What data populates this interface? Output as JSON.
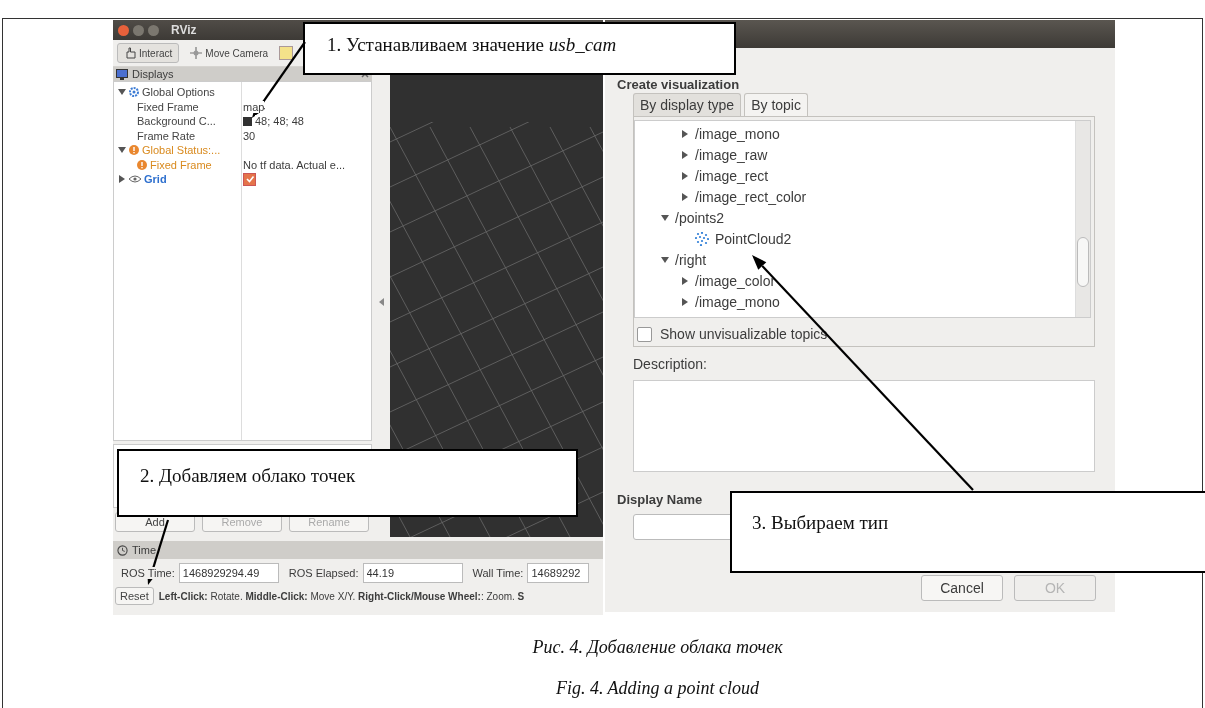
{
  "rviz_window": {
    "title": "RViz",
    "toolbar": [
      {
        "label": "Interact",
        "selected": true
      },
      {
        "label": "Move Camera",
        "selected": false
      }
    ],
    "displays_panel": {
      "title": "Displays",
      "items": [
        {
          "label": "Global Options",
          "kind": "options",
          "expanded": true,
          "children": [
            {
              "label": "Fixed Frame",
              "kind": "property",
              "value": "map"
            },
            {
              "label": "Background C...",
              "kind": "property",
              "value": "48; 48; 48",
              "swatch": true
            },
            {
              "label": "Frame Rate",
              "kind": "property",
              "value": "30"
            }
          ]
        },
        {
          "label": "Global Status:...",
          "kind": "status",
          "expanded": true,
          "children": [
            {
              "label": "Fixed Frame",
              "kind": "status",
              "value": "No tf data.  Actual e..."
            }
          ]
        },
        {
          "label": "Grid",
          "kind": "display",
          "expanded": false,
          "checked": true
        }
      ]
    },
    "panel_buttons": [
      {
        "label": "Add",
        "disabled": false
      },
      {
        "label": "Remove",
        "disabled": true
      },
      {
        "label": "Rename",
        "disabled": true
      }
    ],
    "time_panel": {
      "title": "Time",
      "fields": [
        {
          "label": "ROS Time:",
          "value": "1468929294.49"
        },
        {
          "label": "ROS Elapsed:",
          "value": "44.19"
        },
        {
          "label": "Wall Time:",
          "value": "14689292"
        }
      ],
      "reset_button": "Reset",
      "hint": "**Left-Click:** Rotate. **Middle-Click:** Move X/Y. **Right-Click/Mouse Wheel:**: Zoom. **S**"
    }
  },
  "dialog": {
    "heading": "Create visualization",
    "tabs": [
      {
        "label": "By display type",
        "selected": false
      },
      {
        "label": "By topic",
        "selected": true
      }
    ],
    "topic_tree": {
      "continued_children": [
        {
          "label": "/image_mono",
          "expanded": false
        },
        {
          "label": "/image_raw",
          "expanded": false
        },
        {
          "label": "/image_rect",
          "expanded": false
        },
        {
          "label": "/image_rect_color",
          "expanded": false
        }
      ],
      "items": [
        {
          "label": "/points2",
          "expanded": true,
          "children": [
            {
              "label": "PointCloud2",
              "kind": "display"
            }
          ]
        },
        {
          "label": "/right",
          "expanded": true,
          "children": [
            {
              "label": "/image_color",
              "expanded": false
            },
            {
              "label": "/image_mono",
              "expanded": false
            }
          ]
        }
      ]
    },
    "show_unvisualizable": {
      "label": "Show unvisualizable topics",
      "checked": false
    },
    "description_label": "Description:",
    "display_name_label": "Display Name",
    "buttons": [
      {
        "label": "Cancel",
        "disabled": false
      },
      {
        "label": "OK",
        "disabled": true
      }
    ]
  },
  "callouts": [
    {
      "text": "1. Устанавливаем значение *usb_cam*"
    },
    {
      "text": "2. Добавляем облако точек"
    },
    {
      "text": "3. Выбираем тип"
    }
  ],
  "caption": [
    "Рис. 4. Добавление облака точек",
    "Fig. 4. Adding a point cloud"
  ]
}
